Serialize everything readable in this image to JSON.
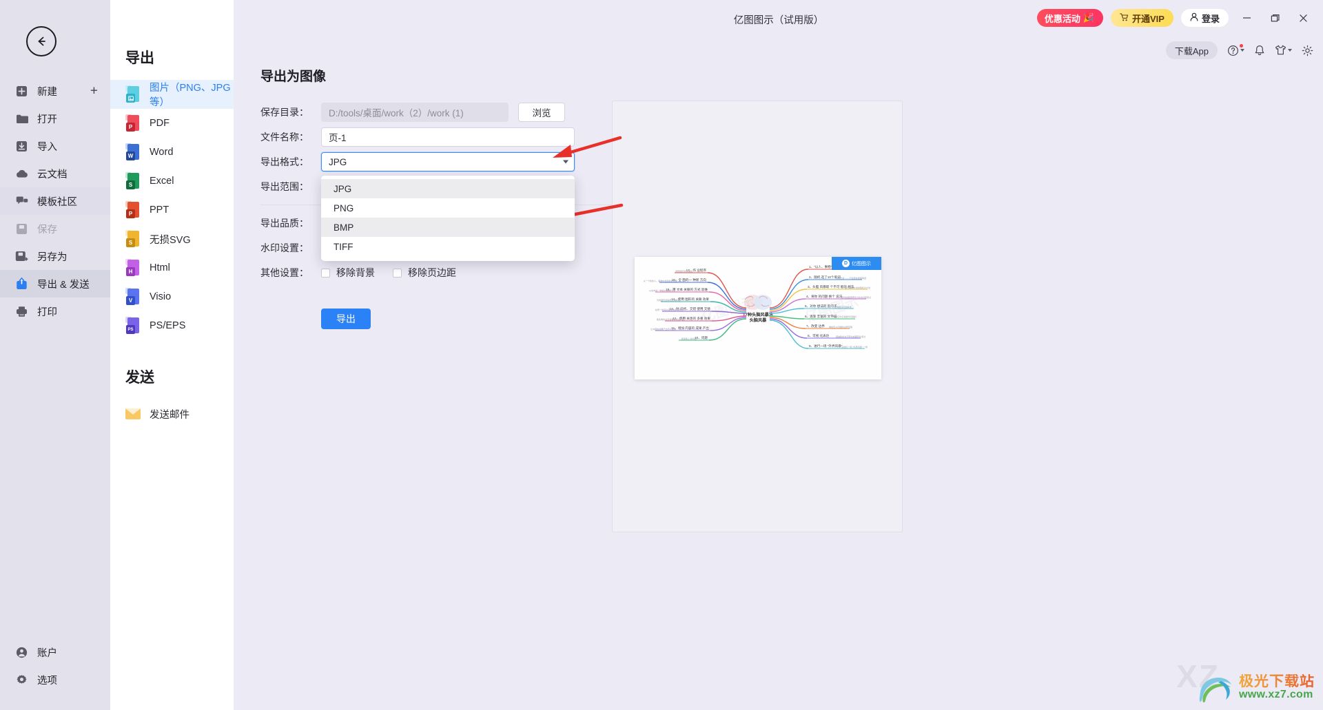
{
  "window": {
    "title": "亿图图示（试用版）",
    "minimize_icon": "minimize-icon",
    "maximize_icon": "maximize-icon",
    "close_icon": "close-icon"
  },
  "topbar": {
    "promo_label": "优惠活动",
    "vip_label": "开通VIP",
    "login_label": "登录",
    "download_app_label": "下载App",
    "help_icon": "help-icon",
    "bell_icon": "bell-icon",
    "theme_icon": "shirt-icon",
    "settings_icon": "gear-icon",
    "accent": "#2b82f6"
  },
  "rail": {
    "back_icon": "back-arrow-icon",
    "items": [
      {
        "label": "新建",
        "icon": "new-file-icon",
        "state": "normal"
      },
      {
        "label": "打开",
        "icon": "folder-icon",
        "state": "normal"
      },
      {
        "label": "导入",
        "icon": "import-icon",
        "state": "normal"
      },
      {
        "label": "云文档",
        "icon": "cloud-icon",
        "state": "normal"
      },
      {
        "label": "模板社区",
        "icon": "community-icon",
        "state": "highlight"
      },
      {
        "label": "保存",
        "icon": "save-icon",
        "state": "disabled"
      },
      {
        "label": "另存为",
        "icon": "save-as-icon",
        "state": "normal"
      },
      {
        "label": "导出 & 发送",
        "icon": "export-icon",
        "state": "active"
      },
      {
        "label": "打印",
        "icon": "printer-icon",
        "state": "normal"
      }
    ],
    "plus_icon": "plus-icon",
    "bottom_items": [
      {
        "label": "账户",
        "icon": "account-icon"
      },
      {
        "label": "选项",
        "icon": "options-gear-icon"
      }
    ]
  },
  "export_panel": {
    "heading": "导出",
    "items": [
      {
        "label": "图片（PNG、JPG等）",
        "icon": "image-file-icon",
        "badge": "",
        "color": "#5ecfe0",
        "tab": "#b7e9f1",
        "selected": true
      },
      {
        "label": "PDF",
        "icon": "pdf-file-icon",
        "badge": "P",
        "color": "#ef4b5a",
        "tab": "#f8a4ac",
        "selected": false
      },
      {
        "label": "Word",
        "icon": "word-file-icon",
        "badge": "W",
        "color": "#3b6fd4",
        "tab": "#a4bcef",
        "selected": false
      },
      {
        "label": "Excel",
        "icon": "excel-file-icon",
        "badge": "S",
        "color": "#1e9a5c",
        "tab": "#9fd8bd",
        "selected": false
      },
      {
        "label": "PPT",
        "icon": "ppt-file-icon",
        "badge": "P",
        "color": "#e2502f",
        "tab": "#f5ab98",
        "selected": false
      },
      {
        "label": "无损SVG",
        "icon": "svg-file-icon",
        "badge": "S",
        "color": "#f0b52e",
        "tab": "#fadf9c",
        "selected": false
      },
      {
        "label": "Html",
        "icon": "html-file-icon",
        "badge": "H",
        "color": "#c261e8",
        "tab": "#e6bcf6",
        "selected": false
      },
      {
        "label": "Visio",
        "icon": "visio-file-icon",
        "badge": "V",
        "color": "#5a74ef",
        "tab": "#b6c2f8",
        "selected": false
      },
      {
        "label": "PS/EPS",
        "icon": "ps-file-icon",
        "badge": "PS",
        "color": "#7a63e8",
        "tab": "#c2b6f6",
        "selected": false
      }
    ],
    "send_heading": "发送",
    "send_items": [
      {
        "label": "发送邮件",
        "icon": "mail-icon"
      }
    ]
  },
  "form": {
    "title": "导出为图像",
    "save_dir": {
      "label": "保存目录：",
      "value": "D:/tools/桌面/work（2）/work (1)",
      "placeholder": "D:/tools/桌面/work（2）/work (1)",
      "browse_label": "浏览",
      "readonly": true
    },
    "file_name": {
      "label": "文件名称：",
      "value": "页-1",
      "placeholder": "页-1"
    },
    "export_format": {
      "label": "导出格式：",
      "value": "JPG",
      "focused": true,
      "open": true,
      "caret_icon": "chevron-down-icon",
      "options": [
        {
          "label": "JPG",
          "highlighted": true
        },
        {
          "label": "PNG",
          "highlighted": false
        },
        {
          "label": "BMP",
          "highlighted": true
        },
        {
          "label": "TIFF",
          "highlighted": false
        }
      ]
    },
    "export_range": {
      "label": "导出范围："
    },
    "export_quality": {
      "label": "导出品质："
    },
    "watermark_setting": {
      "label": "水印设置："
    },
    "other_settings": {
      "label": "其他设置：",
      "checkboxes": [
        {
          "label": "移除背景",
          "checked": false
        },
        {
          "label": "移除页边距",
          "checked": false
        }
      ]
    },
    "submit_label": "导出"
  },
  "preview": {
    "badge_label": "亿图图示",
    "badge_mark": "D",
    "mindmap": {
      "center": [
        "17种头脑风暴法",
        "头脑风暴"
      ],
      "right_branches": [
        {
          "text": "1、\"以人、事物\"成为 灵感",
          "color": "#e0544a"
        },
        {
          "text": "2、随机选了10个单词",
          "color": "#3d8ede"
        },
        {
          "text": "3、头脑风暴取 个不可能的 想法",
          "color": "#f0c040"
        },
        {
          "text": "4、将你 的问题 换个 说法",
          "color": "#c96fd6"
        },
        {
          "text": "5、对你 想法的 反问",
          "color": "#49c2dd"
        },
        {
          "text": "6、逐渐 丰富的 文字描述",
          "color": "#45c07e"
        },
        {
          "text": "7、改变 边界",
          "color": "#ef7f3c"
        },
        {
          "text": "8、可视 化表达",
          "color": "#8f6fe0"
        },
        {
          "text": "9、进行一场 \"外界风暴\"",
          "color": "#49bdcf"
        }
      ],
      "left_branches": [
        {
          "text": "17、作 业程序",
          "color": "#e0544a"
        },
        {
          "text": "16、全 面的一 种新 方向",
          "color": "#3d6fd8"
        },
        {
          "text": "15、用 文本 关联的 方式 思维",
          "color": "#e26aa5"
        },
        {
          "text": "14、使用 图形的 关联 效果",
          "color": "#38b6a8"
        },
        {
          "text": "13、时 间点、交错 使用 交替",
          "color": "#8a63d6"
        },
        {
          "text": "12、使用 关连的 多重 效果",
          "color": "#e0548e"
        },
        {
          "text": "11、增加 内容的 成果 产出",
          "color": "#9b6fe0"
        },
        {
          "text": "10、问题",
          "color": "#3fb982"
        }
      ]
    }
  },
  "annotations": {
    "arrow_color": "#e8302a",
    "arrow_1_target": "export-format-dropdown-toggle",
    "arrow_2_target": "dropdown-option-bmp",
    "cursor_icon": "mouse-cursor"
  },
  "watermark": {
    "cn_text": "极光下载站",
    "url_text": "www.xz7.com",
    "ghost_text": "XZ"
  }
}
